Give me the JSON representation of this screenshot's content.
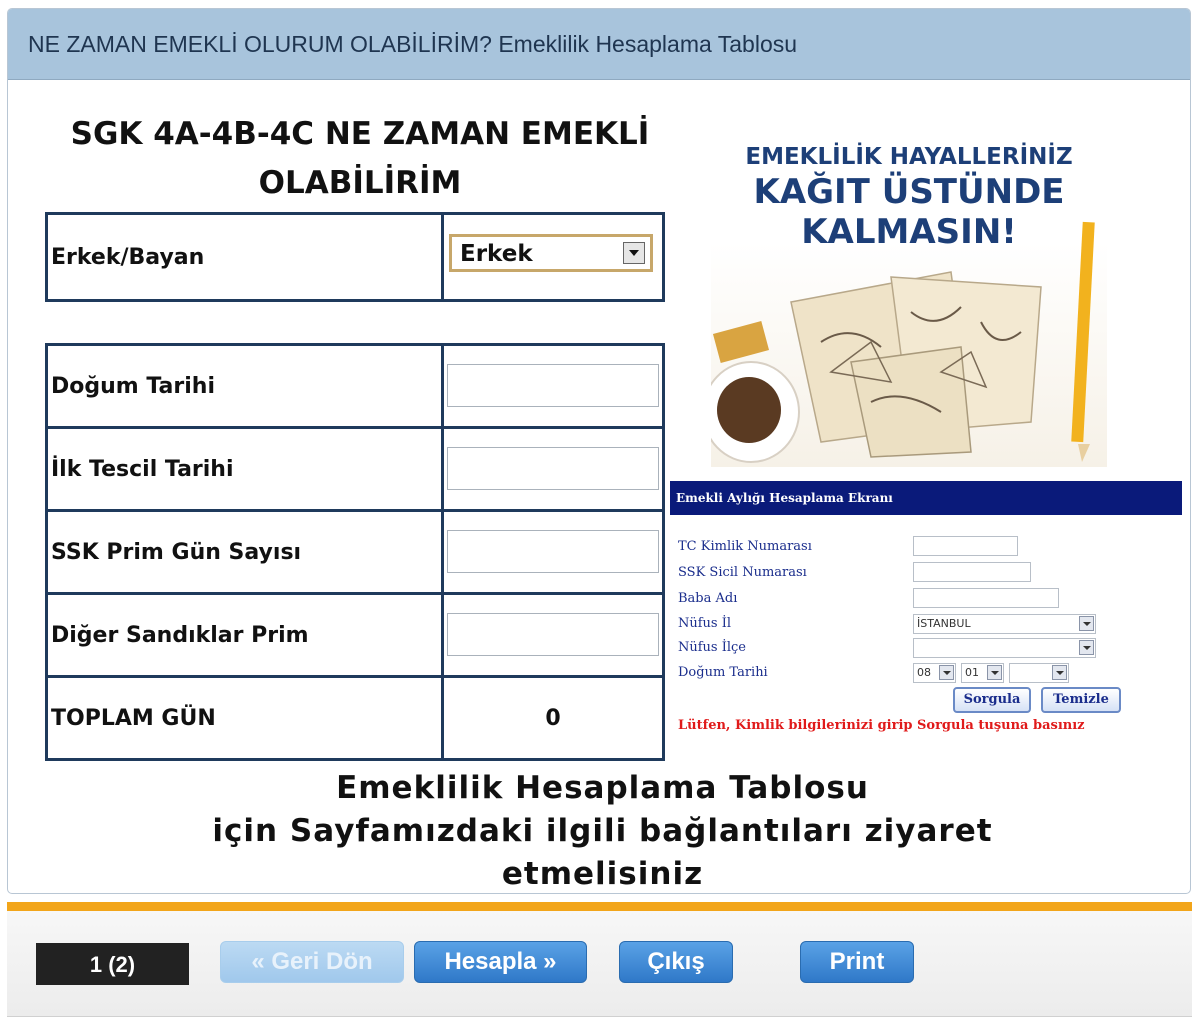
{
  "header": {
    "title": "NE ZAMAN EMEKLİ OLURUM OLABİLİRİM? Emeklilik Hesaplama Tablosu"
  },
  "form": {
    "title_line1": "SGK 4A-4B-4C NE ZAMAN EMEKLİ",
    "title_line2": "OLABİLİRİM",
    "gender_label": "Erkek/Bayan",
    "gender_value": "Erkek",
    "rows": [
      {
        "label": "Doğum Tarihi",
        "value": ""
      },
      {
        "label": "İlk Tescil Tarihi",
        "value": ""
      },
      {
        "label": "SSK Prim Gün Sayısı",
        "value": ""
      },
      {
        "label": "Diğer Sandıklar Prim",
        "value": ""
      }
    ],
    "total_label": "TOPLAM GÜN",
    "total_value": "0"
  },
  "ad": {
    "line1": "EMEKLİLİK HAYALLERİNİZ",
    "line2": "KAĞIT ÜSTÜNDE",
    "line3": "KALMASIN!"
  },
  "mini_form": {
    "header": "Emekli Aylığı Hesaplama Ekranı",
    "labels": [
      "TC Kimlik Numarası",
      "SSK Sicil Numarası",
      "Baba Adı",
      "Nüfus İl",
      "Nüfus İlçe",
      "Doğum Tarihi"
    ],
    "city_value": "İSTANBUL",
    "day_value": "08",
    "month_value": "01",
    "query_button": "Sorgula",
    "clear_button": "Temizle",
    "note": "Lütfen, Kimlik bilgilerinizi girip Sorgula tuşuna basınız"
  },
  "promo": {
    "line1": "Emeklilik Hesaplama Tablosu",
    "line2": "için Sayfamızdaki ilgili bağlantıları ziyaret",
    "line3": "etmelisiniz"
  },
  "footer": {
    "page_indicator": "1 (2)",
    "back_button": "« Geri Dön",
    "calc_button": "Hesapla »",
    "exit_button": "Çıkış",
    "print_button": "Print"
  },
  "colors": {
    "header_bg": "#a8c4dc",
    "table_border": "#1f3a5c",
    "accent_orange": "#f2a51a",
    "button_blue": "#2f78c8",
    "mini_header_bg": "#0a1a7a",
    "note_red": "#e01a1a"
  }
}
